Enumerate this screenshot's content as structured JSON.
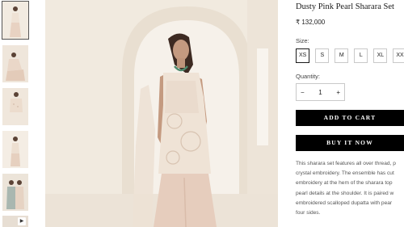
{
  "gallery": {
    "thumbnails": [
      "image-1",
      "image-2",
      "image-3",
      "image-4",
      "image-5",
      "video-6"
    ],
    "active_index": 0
  },
  "product": {
    "title": "Dusty Pink Pearl Sharara Set",
    "price": "₹ 132,000",
    "size_label": "Size:",
    "sizes": [
      "XS",
      "S",
      "M",
      "L",
      "XL",
      "XX"
    ],
    "selected_size": "XS",
    "quantity_label": "Quantity:",
    "quantity": "1",
    "qty_minus": "−",
    "qty_plus": "+",
    "add_to_cart": "ADD TO CART",
    "buy_now": "BUY IT NOW",
    "description_lines": [
      "This sharara set features all over thread, p",
      "crystal embroidery. The ensemble has cut",
      "embroidery at the hem of the sharara top",
      "pearl details at the shoulder. It is paired w",
      "embroidered scalloped dupatta with pear",
      "four sides."
    ]
  },
  "colors": {
    "button_bg": "#000000",
    "button_text": "#ffffff",
    "outfit": "#e9d4c4",
    "wall": "#f1eadf"
  }
}
